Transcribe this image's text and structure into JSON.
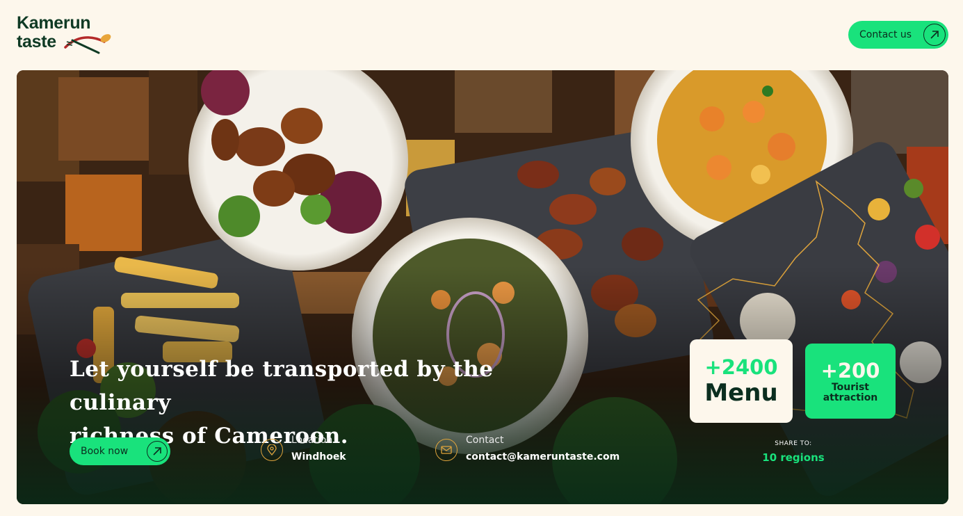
{
  "brand": {
    "logo_line1": "Kamerun",
    "logo_line2": "taste",
    "logo_accent_colors": [
      "#b42a2a",
      "#e8a53a",
      "#0f3a24"
    ]
  },
  "header": {
    "contact_label": "Contact us",
    "contact_icon": "arrow-up-right-icon"
  },
  "hero": {
    "headline_line1": "Let yourself be transported by the culinary",
    "headline_line2": "richness of Cameroon.",
    "book_label": "Book now",
    "book_icon": "arrow-up-right-icon",
    "location": {
      "label": "Location",
      "value": "Windhoek",
      "icon": "map-pin-icon"
    },
    "contact": {
      "label": "Contact",
      "value": "contact@kameruntaste.com",
      "icon": "mail-icon"
    },
    "stats": {
      "menu": {
        "number": "+2400",
        "label": "Menu"
      },
      "tourist": {
        "number": "+200",
        "label_line1": "Tourist",
        "label_line2": "attraction"
      }
    },
    "share": {
      "caption": "SHARE TO:",
      "regions": "10 regions"
    }
  },
  "colors": {
    "accent": "#19e27c",
    "cream": "#fdf7ec",
    "dark_green": "#0b2e1f",
    "map_outline": "#e0a53c"
  }
}
